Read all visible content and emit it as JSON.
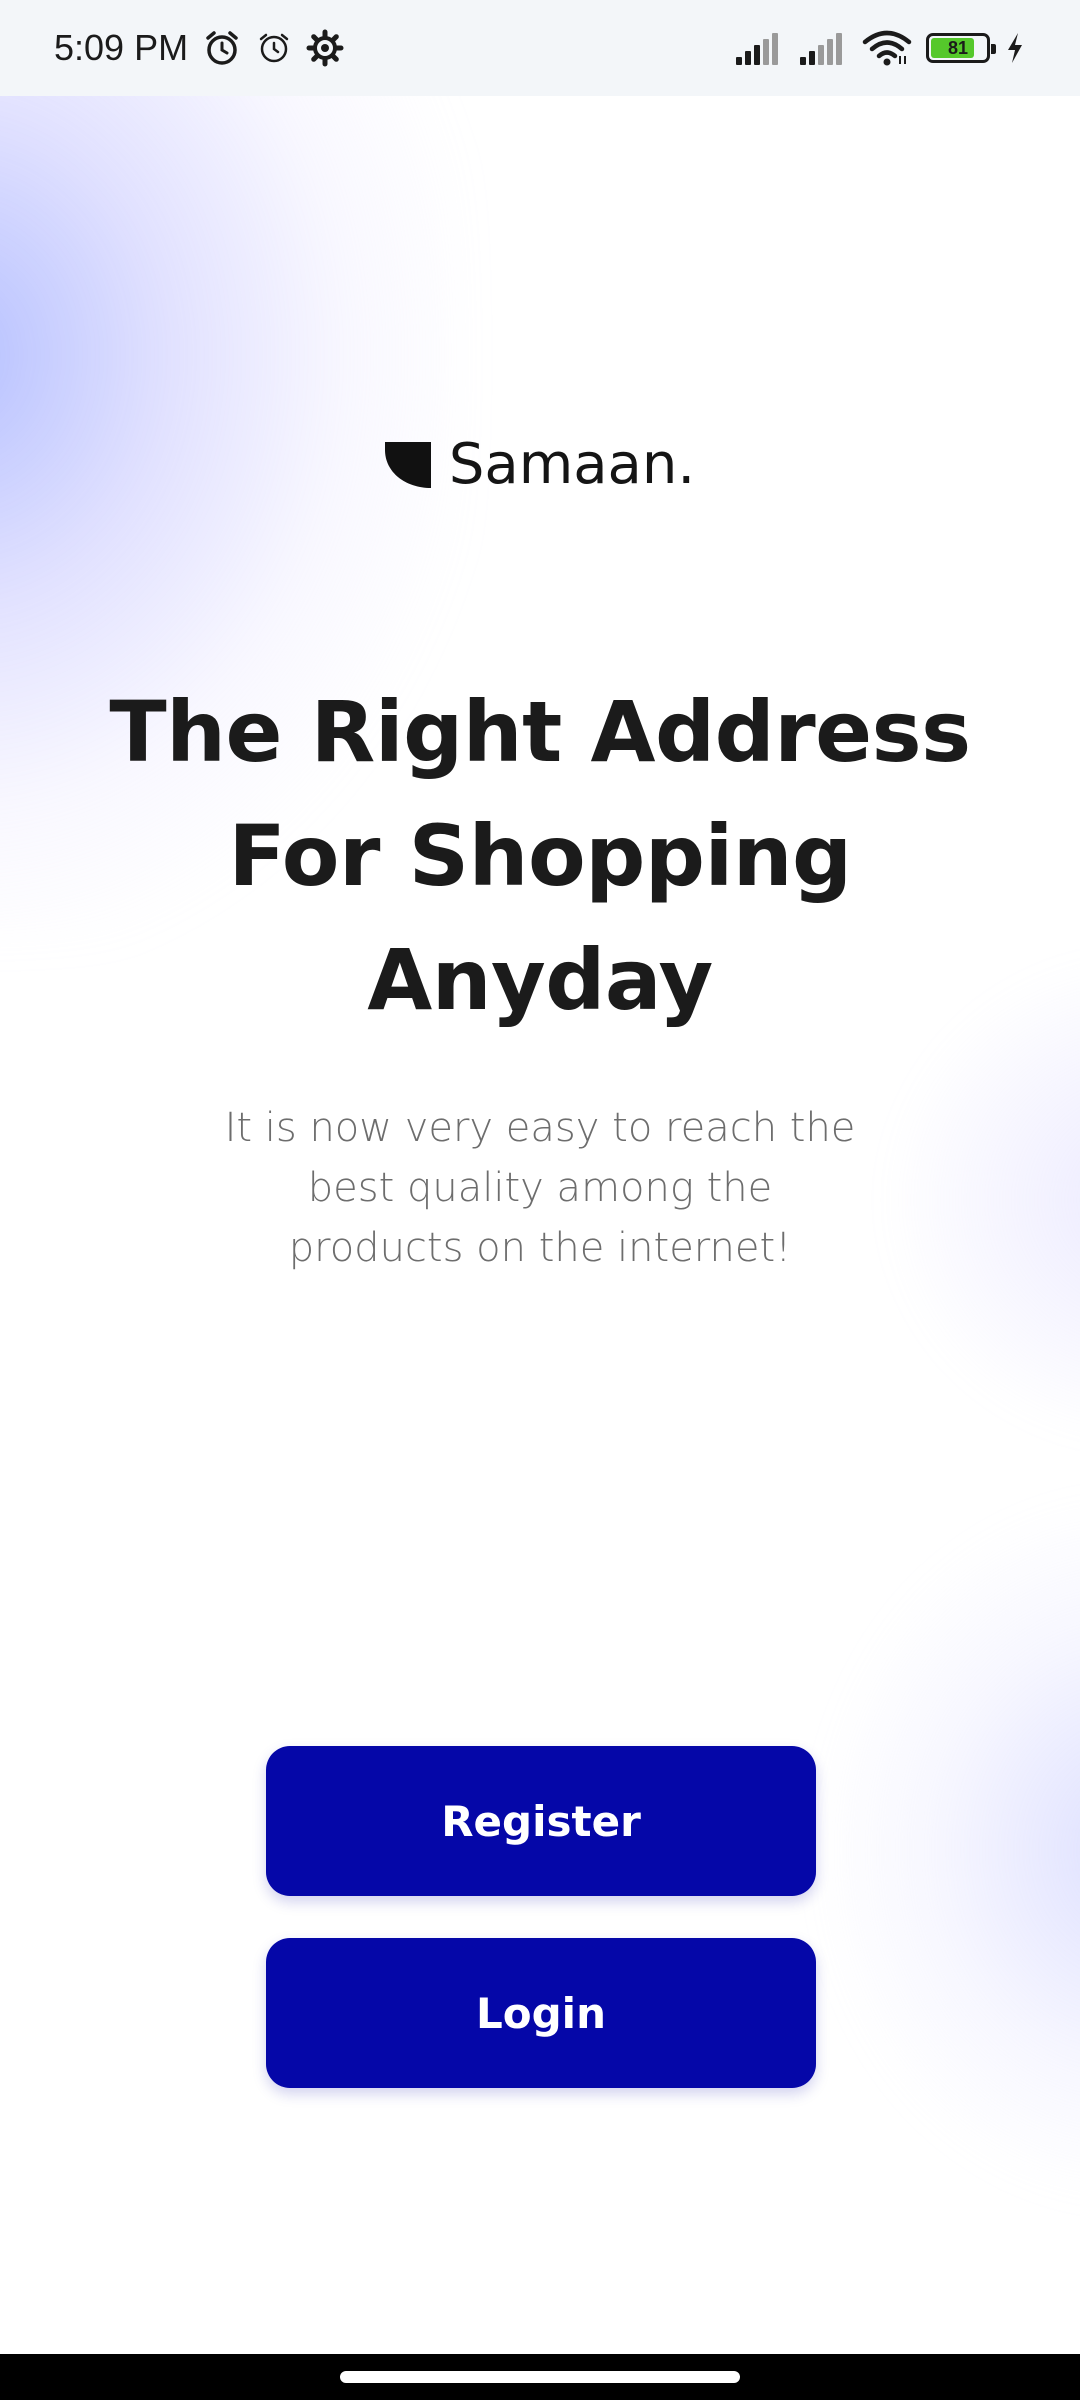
{
  "status_bar": {
    "time": "5:09 PM",
    "icons": [
      "alarm-icon",
      "clock-icon",
      "gear-icon",
      "signal-icon",
      "signal-icon",
      "wifi-icon",
      "battery-icon",
      "charging-icon"
    ],
    "battery_level": "81",
    "battery_fraction": 0.81,
    "battery_color": "#55c82b"
  },
  "brand": {
    "logo_icon": "shield-icon",
    "name": "Samaan."
  },
  "hero": {
    "headline_line1": "The Right Address",
    "headline_line2": "For Shopping",
    "headline_line3": "Anyday",
    "subtext_line1": "It is now very easy to reach the",
    "subtext_line2": "best quality among the",
    "subtext_line3": "products on the internet!"
  },
  "actions": {
    "register_label": "Register",
    "login_label": "Login",
    "button_color": "#0507a8"
  },
  "colors": {
    "text_dark": "#1b1b1b",
    "text_muted": "#6d6d6d"
  }
}
